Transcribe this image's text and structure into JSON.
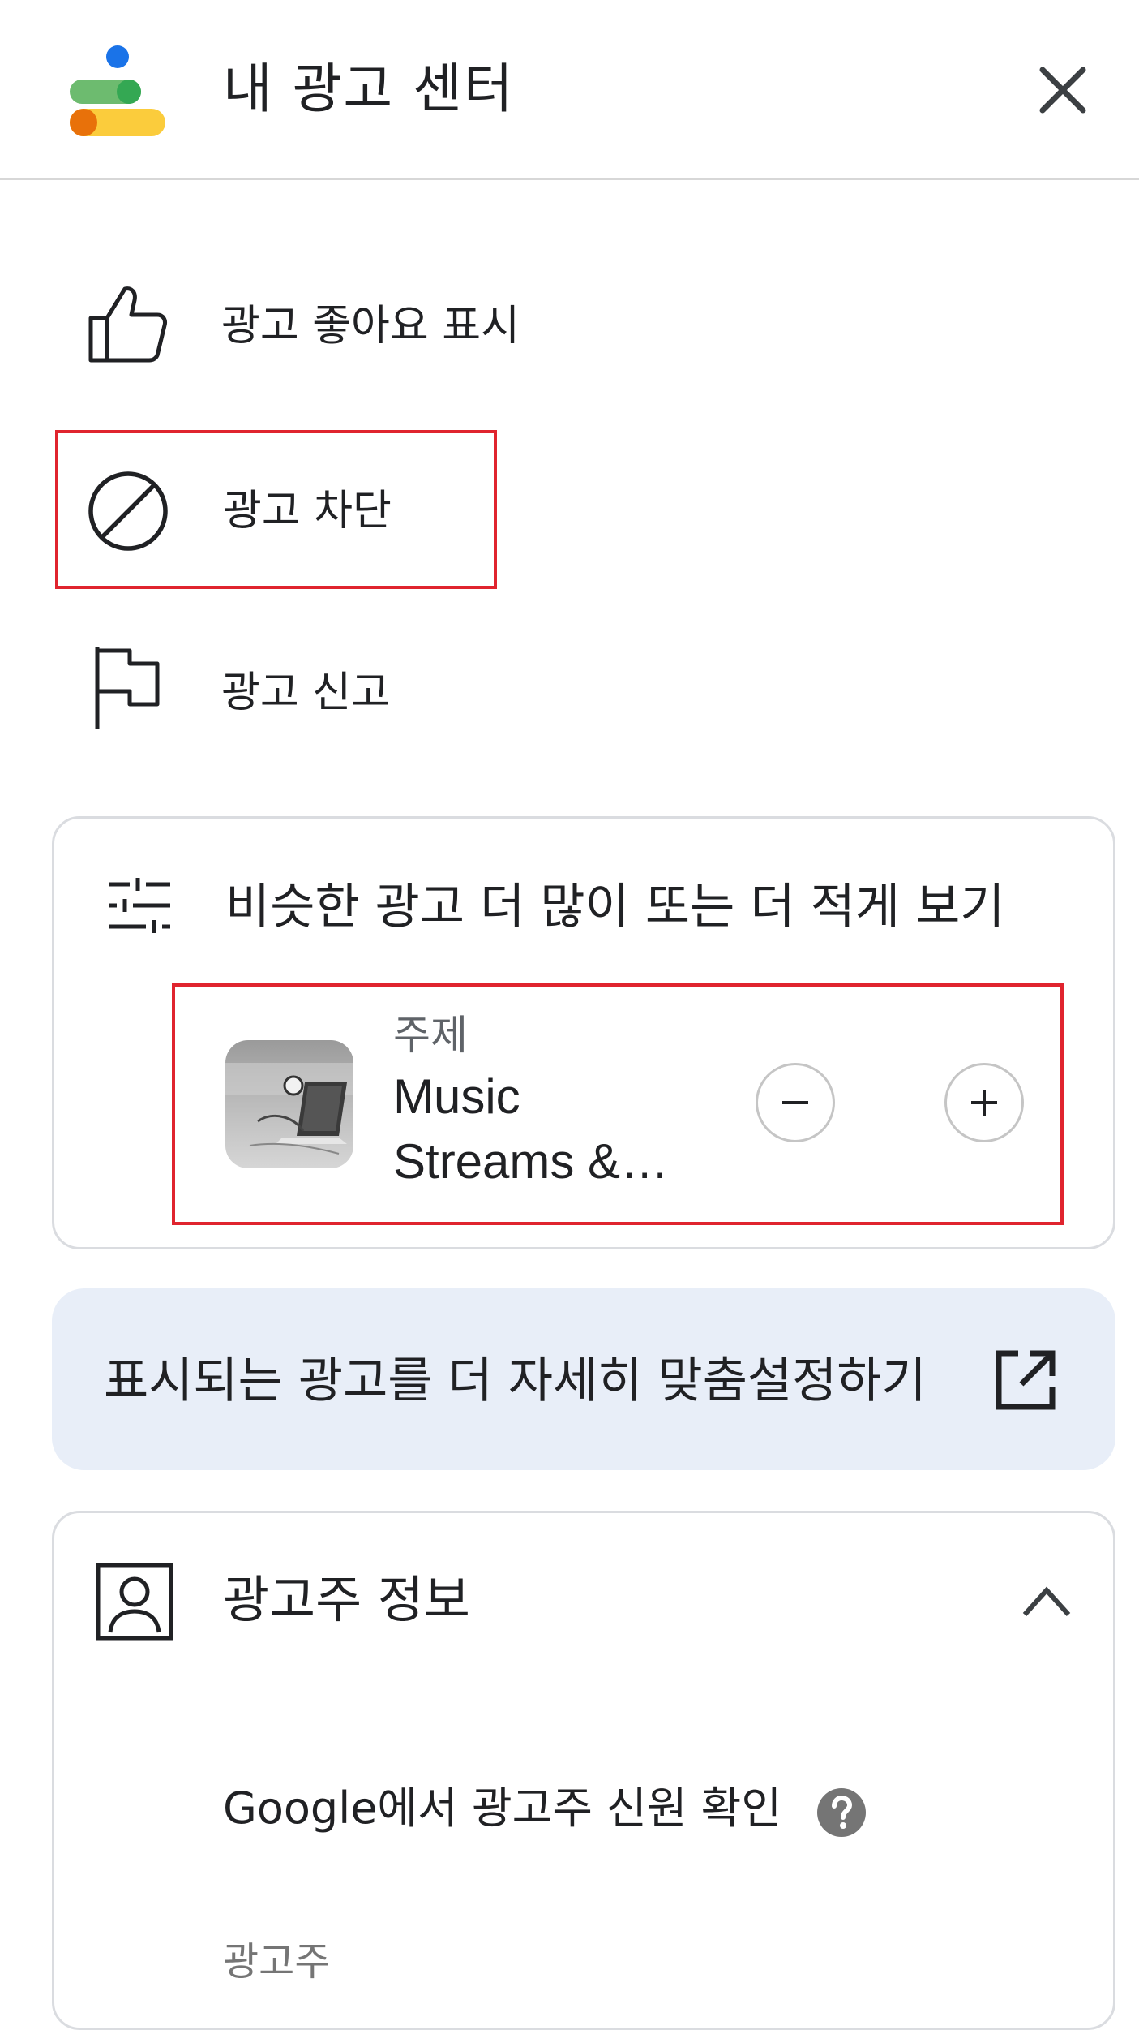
{
  "header": {
    "title": "내 광고 센터",
    "close_icon": "close-icon"
  },
  "menu": [
    {
      "label": "광고 좋아요 표시",
      "icon": "thumb-up-icon"
    },
    {
      "label": "광고 차단",
      "icon": "block-icon"
    },
    {
      "label": "광고 신고",
      "icon": "flag-icon"
    }
  ],
  "similar": {
    "title": "비슷한 광고 더 많이 또는 더 적게 보기",
    "topic": {
      "kind": "주제",
      "name": "Music Streams &…"
    }
  },
  "customize": {
    "label": "표시되는 광고를 더 자세히 맞춤설정하기"
  },
  "advertiser": {
    "title": "광고주 정보",
    "verify_label": "Google에서 광고주 신원 확인",
    "advertiser_label": "광고주"
  },
  "colors": {
    "highlight": "#e0242e",
    "logo_blue": "#1a73e8",
    "logo_green": "#34a853",
    "logo_yellow": "#fbbc04",
    "logo_orange": "#e8710a",
    "customize_bg": "#e8eef8"
  }
}
